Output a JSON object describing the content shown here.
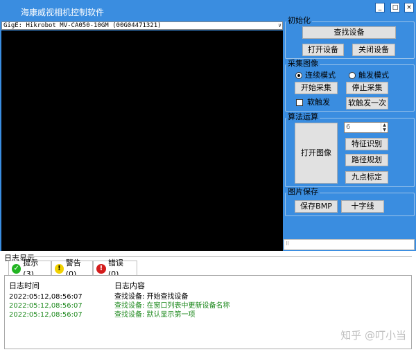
{
  "window": {
    "title": "海康威视相机控制软件",
    "controls": [
      "_",
      "□",
      "×"
    ]
  },
  "camera": {
    "selected": "GigE: Hikrobot MV-CA050-10GM (00G04471321)",
    "arrow": "∨"
  },
  "init_group": {
    "title": "初始化",
    "find_device": "查找设备",
    "open_device": "打开设备",
    "close_device": "关闭设备"
  },
  "capture_group": {
    "title": "采集图像",
    "continuous_mode": "连续模式",
    "trigger_mode": "触发模式",
    "start_capture": "开始采集",
    "stop_capture": "停止采集",
    "soft_trigger": "软触发",
    "soft_trigger_once": "软触发一次"
  },
  "algo_group": {
    "title": "算法运算",
    "open_image": "打开图像",
    "spin_value": "6",
    "feature_recognition": "特征识别",
    "path_planning": "路径规划",
    "nine_point_calibration": "九点标定"
  },
  "save_group": {
    "title": "图片保存",
    "save_bmp": "保存BMP",
    "crosshair": "十字线"
  },
  "log": {
    "heading": "日志显示",
    "tabs": [
      {
        "label": "提示(3)",
        "icon": "info-check-icon",
        "color": "#22b422"
      },
      {
        "label": "警告(0)",
        "icon": "warning-icon",
        "color": "#f2d200"
      },
      {
        "label": "错误(0)",
        "icon": "error-icon",
        "color": "#d41c1c"
      }
    ],
    "columns": [
      "日志时间",
      "日志内容"
    ],
    "rows": [
      {
        "time": "2022:05:12,08:56:07",
        "content": "查找设备: 开始查找设备",
        "color": "#000000"
      },
      {
        "time": "2022:05:12,08:56:07",
        "content": "查找设备: 在窗口列表中更新设备名称",
        "color": "#1f8a1f"
      },
      {
        "time": "2022:05:12,08:56:07",
        "content": "查找设备: 默认显示第一项",
        "color": "#1f8a1f"
      }
    ]
  },
  "watermark": "知乎 @叮小当"
}
